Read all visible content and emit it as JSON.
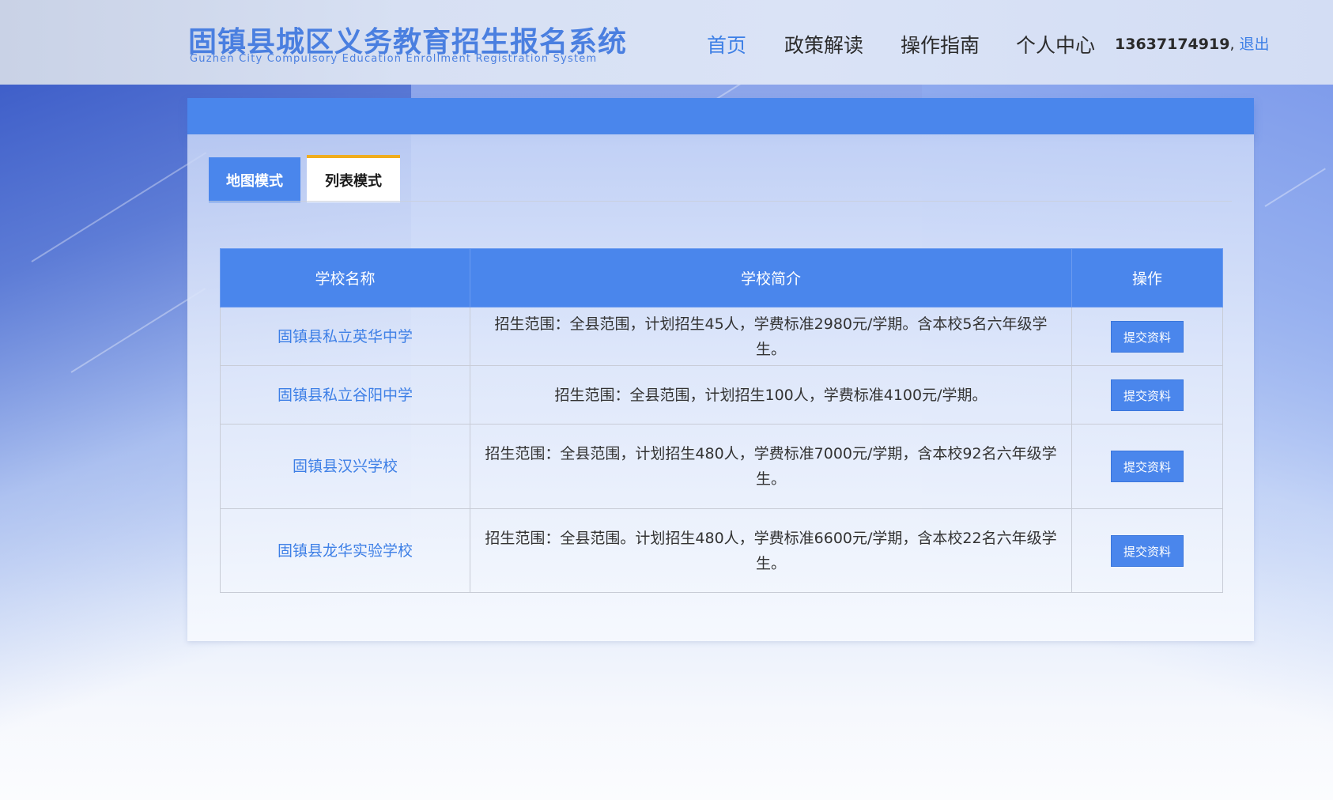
{
  "header": {
    "title_cn": "固镇县城区义务教育招生报名系统",
    "title_en": "Guzhen City Compulsory Education Enrollment Registration System",
    "nav": [
      {
        "label": "首页",
        "active": true
      },
      {
        "label": "政策解读",
        "active": false
      },
      {
        "label": "操作指南",
        "active": false
      },
      {
        "label": "个人中心",
        "active": false
      }
    ],
    "user": {
      "phone": "13637174919",
      "separator": ",",
      "logout": "退出"
    }
  },
  "tabs": {
    "map": "地图模式",
    "list": "列表模式",
    "active": "list"
  },
  "table": {
    "headers": [
      "学校名称",
      "学校简介",
      "操作"
    ],
    "rows": [
      {
        "name": "固镇县私立英华中学",
        "intro": "招生范围：全县范围，计划招生45人，学费标准2980元/学期。含本校5名六年级学生。",
        "action": "提交资料"
      },
      {
        "name": "固镇县私立谷阳中学",
        "intro": "招生范围：全县范围，计划招生100人，学费标准4100元/学期。",
        "action": "提交资料"
      },
      {
        "name": "固镇县汉兴学校",
        "intro": "招生范围：全县范围，计划招生480人，学费标准7000元/学期，含本校92名六年级学生。",
        "action": "提交资料"
      },
      {
        "name": "固镇县龙华实验学校",
        "intro": "招生范围：全县范围。计划招生480人，学费标准6600元/学期，含本校22名六年级学生。",
        "action": "提交资料"
      }
    ]
  },
  "colors": {
    "accent": "#4a86ec",
    "link": "#3d7fe6",
    "tab_active_border": "#f0ad1e"
  }
}
